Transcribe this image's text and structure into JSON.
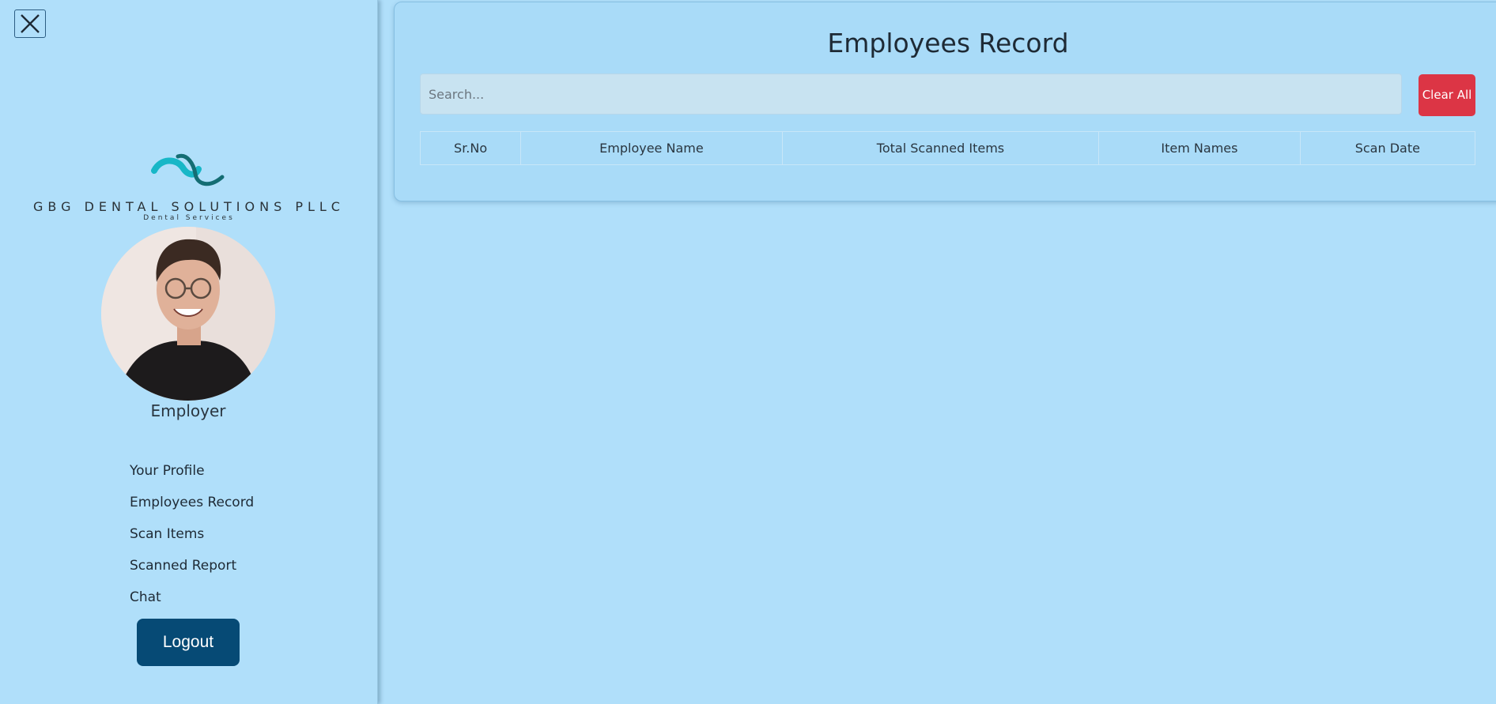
{
  "sidebar": {
    "logo_name": "GBG DENTAL SOLUTIONS PLLC",
    "logo_sub": "Dental Services",
    "role": "Employer",
    "nav": [
      {
        "label": "Your Profile"
      },
      {
        "label": "Employees Record"
      },
      {
        "label": "Scan Items"
      },
      {
        "label": "Scanned Report"
      },
      {
        "label": "Chat"
      }
    ],
    "logout_label": "Logout",
    "close_icon": "close-icon"
  },
  "main": {
    "title": "Employees Record",
    "search_placeholder": "Search...",
    "clear_label": "Clear All",
    "table": {
      "headers": [
        "Sr.No",
        "Employee Name",
        "Total Scanned Items",
        "Item Names",
        "Scan Date"
      ],
      "rows": []
    }
  },
  "colors": {
    "background": "#b0dffa",
    "logout": "#064a75",
    "clear": "#dc3545",
    "logo_teal": "#18b7c7"
  }
}
